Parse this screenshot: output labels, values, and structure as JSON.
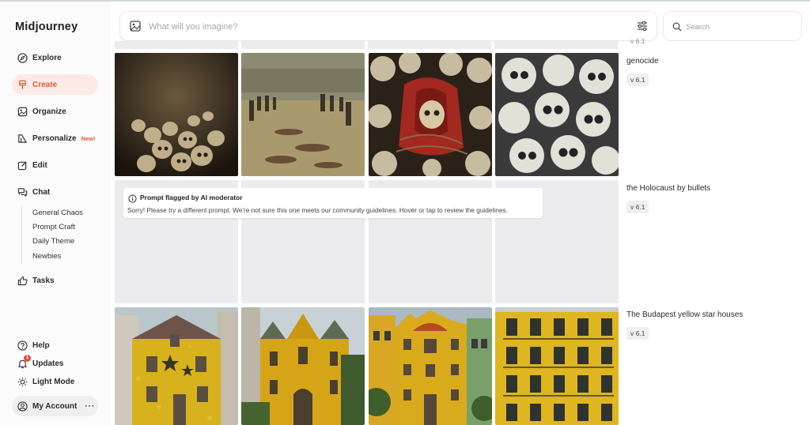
{
  "app": {
    "name": "Midjourney"
  },
  "nav": {
    "explore": "Explore",
    "create": "Create",
    "organize": "Organize",
    "personalize": "Personalize",
    "personalize_badge": "New!",
    "edit": "Edit",
    "chat": "Chat",
    "chat_rooms": [
      "General Chaos",
      "Prompt Craft",
      "Daily Theme",
      "Newbies"
    ],
    "tasks": "Tasks",
    "help": "Help",
    "updates": "Updates",
    "updates_count": "1",
    "light_mode": "Light Mode",
    "account": "My Account",
    "account_more": "···"
  },
  "prompt_bar": {
    "placeholder": "What will you imagine?"
  },
  "search": {
    "placeholder": "Search"
  },
  "feed": {
    "prev_version": "v 6.1",
    "jobs": [
      {
        "prompt": "genocide",
        "version": "v 6.1"
      },
      {
        "prompt": "the Holocaust by bullets",
        "version": "v 6.1"
      },
      {
        "prompt": "The Budapest yellow star houses",
        "version": "v 6.1"
      }
    ],
    "flag": {
      "title": "Prompt flagged by AI moderator",
      "message": "Sorry! Please try a different prompt. We're not sure this one meets our community guidelines. Hover or tap to review the guidelines."
    }
  },
  "colors": {
    "accent": "#e25a3b",
    "active_bg": "#fdeae6",
    "tile_placeholder": "#ececee"
  }
}
